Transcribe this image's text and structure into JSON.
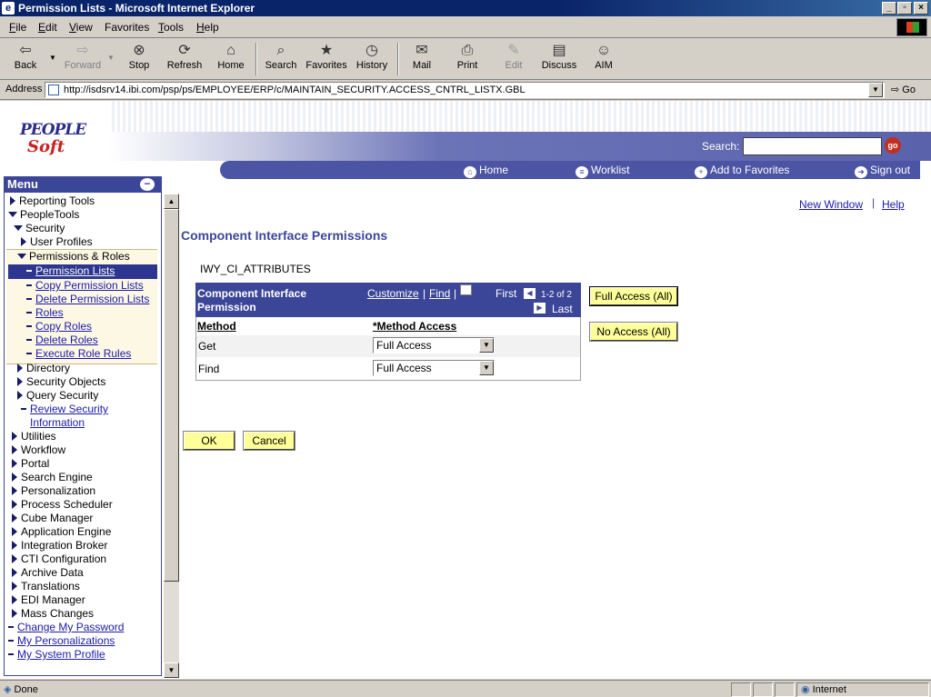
{
  "window": {
    "title": "Permission Lists - Microsoft Internet Explorer"
  },
  "menubar": {
    "items": [
      {
        "label": "File",
        "underline": "F",
        "rest": "ile"
      },
      {
        "label": "Edit",
        "underline": "E",
        "rest": "dit"
      },
      {
        "label": "View",
        "underline": "V",
        "rest": "iew"
      },
      {
        "label": "Favorites",
        "underline": "",
        "rest": ""
      },
      {
        "label": "Tools",
        "underline": "T",
        "rest": "ools"
      },
      {
        "label": "Help",
        "underline": "H",
        "rest": "elp"
      }
    ]
  },
  "toolbar": {
    "back": "Back",
    "forward": "Forward",
    "stop": "Stop",
    "refresh": "Refresh",
    "home": "Home",
    "search": "Search",
    "favorites": "Favorites",
    "history": "History",
    "mail": "Mail",
    "print": "Print",
    "edit": "Edit",
    "discuss": "Discuss",
    "aim": "AIM"
  },
  "address": {
    "label": "Address",
    "url": "http://isdsrv14.ibi.com/psp/ps/EMPLOYEE/ERP/c/MAINTAIN_SECURITY.ACCESS_CNTRL_LISTX.GBL",
    "go": "Go"
  },
  "header": {
    "logo_line1": "PEOPLE",
    "logo_line2": "Soft",
    "search_label": "Search:",
    "go_label": "go",
    "nav": {
      "home": "Home",
      "worklist": "Worklist",
      "favorites": "Add to Favorites",
      "signout": "Sign out"
    }
  },
  "menu": {
    "title": "Menu",
    "reporting_tools": "Reporting Tools",
    "peopletools": "PeopleTools",
    "security": "Security",
    "user_profiles": "User Profiles",
    "perm_roles": "Permissions & Roles",
    "permission_lists": "Permission Lists",
    "copy_permission_lists": "Copy Permission Lists",
    "delete_permission_lists": "Delete Permission Lists",
    "roles": "Roles",
    "copy_roles": "Copy Roles",
    "delete_roles": "Delete Roles",
    "execute_role_rules": "Execute Role Rules",
    "directory": "Directory",
    "security_objects": "Security Objects",
    "query_security": "Query Security",
    "review_security_1": "Review Security",
    "review_security_2": "Information",
    "utilities": "Utilities",
    "workflow": "Workflow",
    "portal": "Portal",
    "search_engine": "Search Engine",
    "personalization": "Personalization",
    "process_scheduler": "Process Scheduler",
    "cube_manager": "Cube Manager",
    "application_engine": "Application Engine",
    "integration_broker": "Integration Broker",
    "cti_configuration": "CTI Configuration",
    "archive_data": "Archive Data",
    "translations": "Translations",
    "edi_manager": "EDI Manager",
    "mass_changes": "Mass Changes",
    "change_password": "Change My Password",
    "my_personalizations": "My Personalizations",
    "my_system_profile": "My System Profile"
  },
  "main": {
    "new_window": "New Window",
    "help": "Help",
    "page_title": "Component Interface Permissions",
    "ci_name": "IWY_CI_ATTRIBUTES",
    "grid": {
      "title_line1": "Component Interface",
      "title_line2": "Permission",
      "customize": "Customize",
      "find": "Find",
      "first": "First",
      "range": "1-2 of 2",
      "last": "Last",
      "col_method": "Method",
      "col_access": "*Method Access",
      "rows": [
        {
          "method": "Get",
          "access": "Full Access"
        },
        {
          "method": "Find",
          "access": "Full Access"
        }
      ]
    },
    "full_access_all": "Full Access (All)",
    "no_access_all": "No Access (All)",
    "ok": "OK",
    "cancel": "Cancel"
  },
  "status": {
    "text": "Done",
    "zone": "Internet"
  }
}
